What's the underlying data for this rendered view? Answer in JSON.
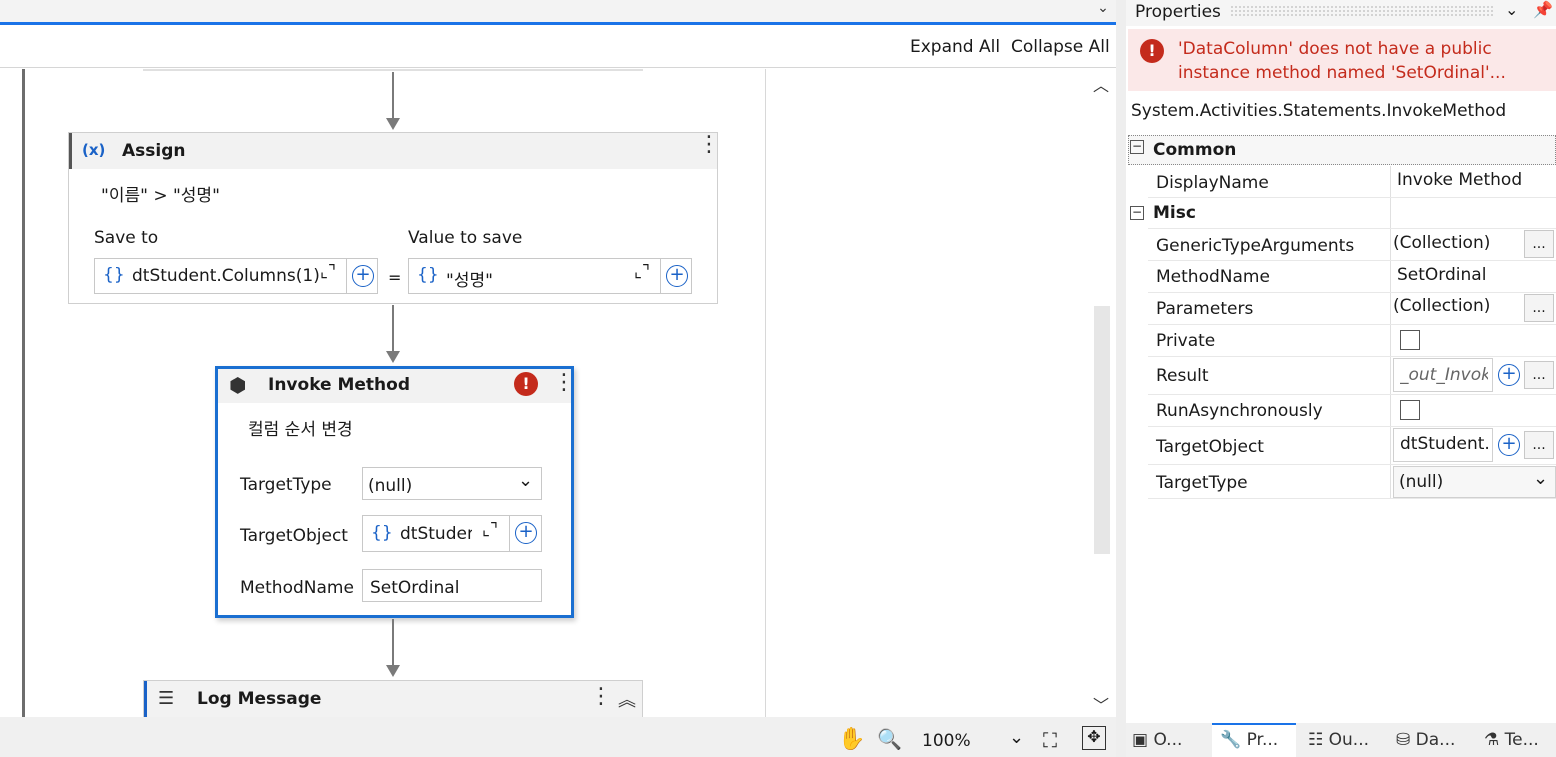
{
  "toolbar": {
    "expand_all": "Expand All",
    "collapse_all": "Collapse All"
  },
  "assign": {
    "title": "Assign",
    "icon": "assign-x-icon",
    "display": "\"이름\" > \"성명\"",
    "save_to_label": "Save to",
    "value_label": "Value to save",
    "save_to_value": "dtStudent.Columns(1)",
    "value_value": "\"성명\"",
    "equals": "="
  },
  "invoke": {
    "title": "Invoke Method",
    "display": "컬럼 순서 변경",
    "target_type_label": "TargetType",
    "target_type_value": "(null)",
    "target_object_label": "TargetObject",
    "target_object_value": "dtStuder",
    "method_name_label": "MethodName",
    "method_name_value": "SetOrdinal"
  },
  "log": {
    "title": "Log Message"
  },
  "status": {
    "zoom": "100%"
  },
  "properties": {
    "title": "Properties",
    "error": "'DataColumn' does not have a public instance method named 'SetOrdinal'...",
    "error_line1": "'DataColumn' does not have a public",
    "error_line2": "instance method named 'SetOrdinal'...",
    "type_name": "System.Activities.Statements.InvokeMethod",
    "common": "Common",
    "misc": "Misc",
    "rows": {
      "display_name": {
        "label": "DisplayName",
        "value": "Invoke Method"
      },
      "generic_type_args": {
        "label": "GenericTypeArguments",
        "value": "(Collection)"
      },
      "method_name": {
        "label": "MethodName",
        "value": "SetOrdinal"
      },
      "parameters": {
        "label": "Parameters",
        "value": "(Collection)"
      },
      "private": {
        "label": "Private"
      },
      "result": {
        "label": "Result",
        "value": "_out_Invok"
      },
      "run_async": {
        "label": "RunAsynchronously"
      },
      "target_object": {
        "label": "TargetObject",
        "value": "dtStudent.("
      },
      "target_type": {
        "label": "TargetType",
        "value": "(null)"
      }
    },
    "dots": "...",
    "tabs": [
      "O...",
      "Pr...",
      "Ou...",
      "Da...",
      "Te..."
    ]
  },
  "colors": {
    "accent": "#1a73e8",
    "error": "#c42b1c",
    "error_bg": "#fbe8e8"
  }
}
